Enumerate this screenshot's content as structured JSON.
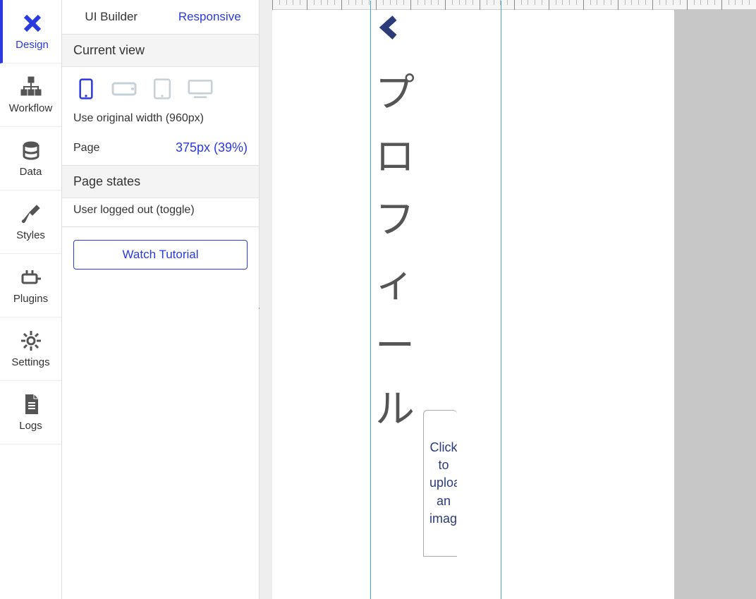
{
  "rail": {
    "items": [
      {
        "label": "Design"
      },
      {
        "label": "Workflow"
      },
      {
        "label": "Data"
      },
      {
        "label": "Styles"
      },
      {
        "label": "Plugins"
      },
      {
        "label": "Settings"
      },
      {
        "label": "Logs"
      }
    ]
  },
  "panel": {
    "tabs": {
      "ui_builder": "UI Builder",
      "responsive": "Responsive"
    },
    "current_view_header": "Current view",
    "use_original": "Use original width (960px)",
    "page_label": "Page",
    "page_value": "375px (39%)",
    "page_states_header": "Page states",
    "state_toggle": "User logged out (toggle)",
    "tutorial": "Watch Tutorial"
  },
  "canvas": {
    "profile_title": "プロフィール",
    "upload_text": "Click to upload an image"
  }
}
